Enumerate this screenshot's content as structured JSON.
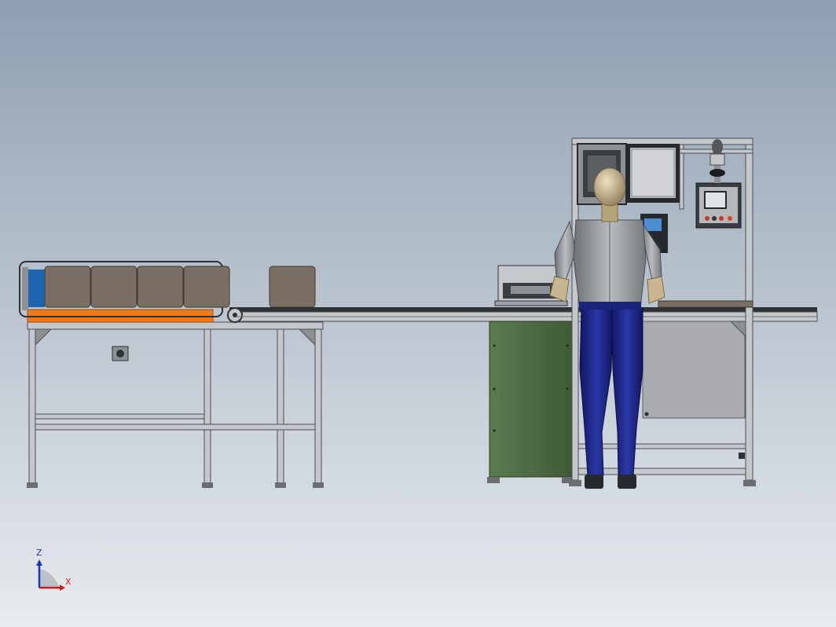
{
  "viewport": {
    "background_top": "#8f9fb0",
    "background_bottom": "#e8ebef"
  },
  "colors": {
    "frame_aluminum": "#c4c8cc",
    "frame_dark": "#4a4e54",
    "conveyor_belt": "#2f3134",
    "orange_rail": "#f07a1a",
    "blue_panel": "#1e64b0",
    "box_brown": "#7b6f63",
    "cabinet_green": "#4f6e45",
    "panel_gray": "#a9abae",
    "mannequin_skin": "#c9b691",
    "shirt_gray": "#8c8f94",
    "pants_blue": "#1a237a",
    "screen_dark": "#26292d"
  },
  "triad": {
    "z_label": "Z",
    "x_label": "X",
    "z_color": "#1c33b8",
    "x_color": "#c61f1f"
  }
}
